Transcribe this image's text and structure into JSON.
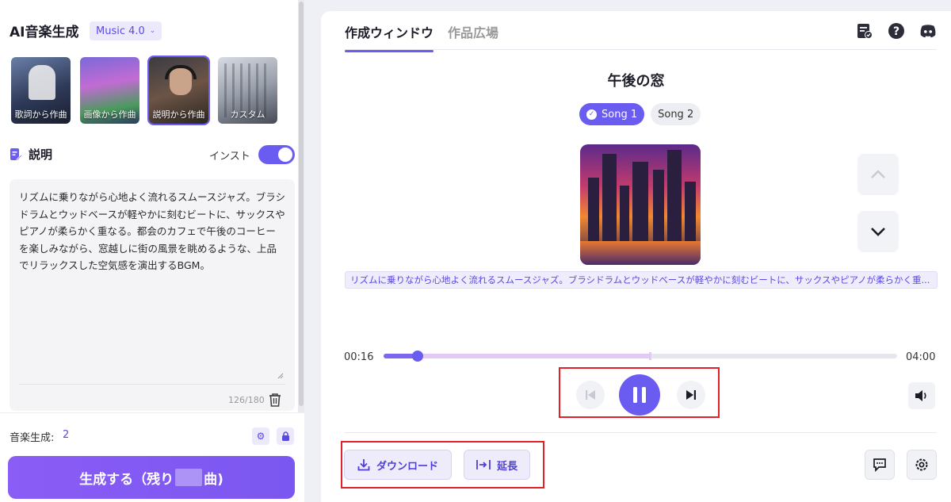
{
  "app": {
    "title": "AI音楽生成",
    "model": "Music 4.0"
  },
  "modes": [
    {
      "label": "歌詞から作曲"
    },
    {
      "label": "画像から作曲"
    },
    {
      "label": "説明から作曲"
    },
    {
      "label": "カスタム"
    }
  ],
  "description": {
    "title": "説明",
    "instrumental_label": "インスト",
    "text": "リズムに乗りながら心地よく流れるスムースジャズ。ブラシドラムとウッドベースが軽やかに刻むビートに、サックスやピアノが柔らかく重なる。都会のカフェで午後のコーヒーを楽しみながら、窓越しに街の風景を眺めるような、上品でリラックスした空気感を演出するBGM。",
    "char_count": "126/180"
  },
  "generation": {
    "label": "音楽生成:",
    "count": "2",
    "button_prefix": "生成する（残り",
    "button_suffix": "曲)"
  },
  "tabs": [
    {
      "label": "作成ウィンドウ"
    },
    {
      "label": "作品広場"
    }
  ],
  "song": {
    "title": "午後の窓",
    "versions": [
      "Song 1",
      "Song 2"
    ],
    "prompt": "リズムに乗りながら心地よく流れるスムースジャズ。ブラシドラムとウッドベースが軽やかに刻むビートに、サックスやピアノが柔らかく重..."
  },
  "player": {
    "current_time": "00:16",
    "total_time": "04:00",
    "progress": 0.067,
    "buffered": 0.52
  },
  "actions": {
    "download": "ダウンロード",
    "extend": "延長"
  },
  "colors": {
    "accent": "#6a5cf0",
    "highlight_box": "#e0212b"
  }
}
